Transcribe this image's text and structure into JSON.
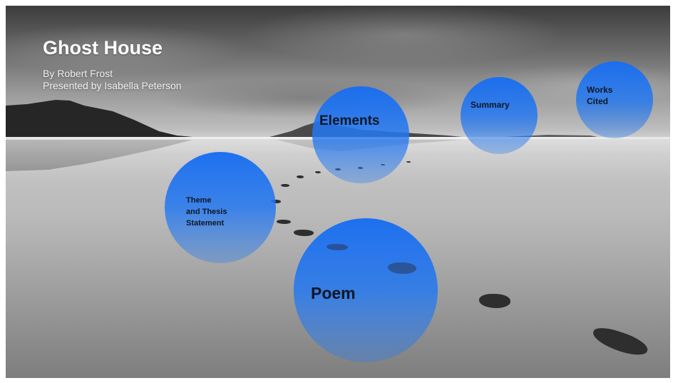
{
  "presentation": {
    "title": "Ghost House",
    "subtitle_line1": "By Robert Frost",
    "subtitle_line2": "Presented by Isabella Peterson"
  },
  "topics": {
    "elements": "Elements",
    "summary": "Summary",
    "works_cited": "Works\nCited",
    "theme": "Theme\nand Thesis\nStatement",
    "poem": "Poem"
  },
  "colors": {
    "bubble_blue": "#1a6ef0",
    "bubble_text": "#101625",
    "title_text": "#ffffff"
  }
}
